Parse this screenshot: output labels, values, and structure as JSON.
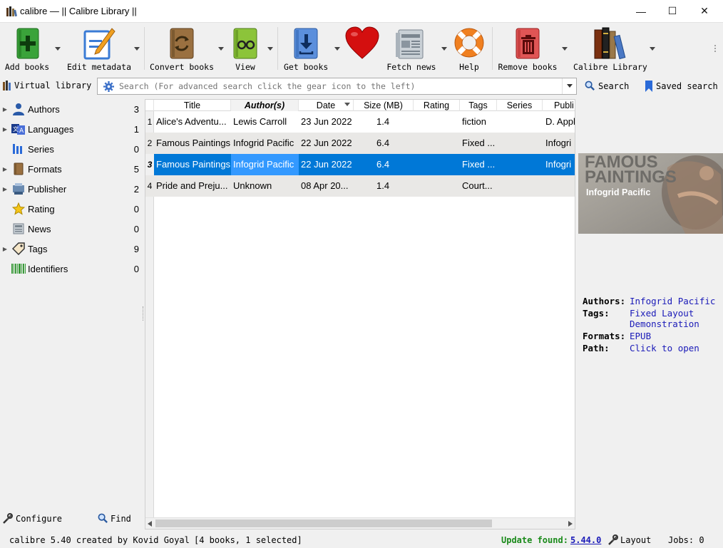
{
  "window": {
    "title": "calibre — || Calibre Library ||",
    "minimize": "—",
    "maximize": "☐",
    "close": "✕"
  },
  "toolbar": {
    "add_books": "Add books",
    "edit_metadata": "Edit metadata",
    "convert_books": "Convert books",
    "view": "View",
    "get_books": "Get books",
    "fetch_news": "Fetch news",
    "help": "Help",
    "remove_books": "Remove books",
    "calibre_library": "Calibre Library"
  },
  "searchbar": {
    "virtual_library": "Virtual library",
    "placeholder": "Search (For advanced search click the gear icon to the left)",
    "search_label": "Search",
    "saved_search_label": "Saved search"
  },
  "tag_browser": {
    "items": [
      {
        "name": "Authors",
        "count": "3",
        "expandable": true,
        "icon": "user-icon"
      },
      {
        "name": "Languages",
        "count": "1",
        "expandable": true,
        "icon": "languages-icon"
      },
      {
        "name": "Series",
        "count": "0",
        "expandable": false,
        "icon": "series-icon"
      },
      {
        "name": "Formats",
        "count": "5",
        "expandable": true,
        "icon": "book-icon"
      },
      {
        "name": "Publisher",
        "count": "2",
        "expandable": true,
        "icon": "publisher-icon"
      },
      {
        "name": "Rating",
        "count": "0",
        "expandable": false,
        "icon": "star-icon"
      },
      {
        "name": "News",
        "count": "0",
        "expandable": false,
        "icon": "news-icon"
      },
      {
        "name": "Tags",
        "count": "9",
        "expandable": true,
        "icon": "tag-icon"
      },
      {
        "name": "Identifiers",
        "count": "0",
        "expandable": false,
        "icon": "barcode-icon"
      }
    ],
    "configure": "Configure",
    "find": "Find"
  },
  "book_list": {
    "columns": [
      "Title",
      "Author(s)",
      "Date",
      "Size (MB)",
      "Rating",
      "Tags",
      "Series",
      "Publi"
    ],
    "rows": [
      {
        "num": "1",
        "title": "Alice's Adventu...",
        "author": "Lewis Carroll",
        "date": "23 Jun 2022",
        "size": "1.4",
        "rating": "",
        "tags": "fiction",
        "series": "",
        "publisher": "D. Appl"
      },
      {
        "num": "2",
        "title": "Famous Paintings",
        "author": "Infogrid Pacific",
        "date": "22 Jun 2022",
        "size": "6.4",
        "rating": "",
        "tags": "Fixed ...",
        "series": "",
        "publisher": "Infogri"
      },
      {
        "num": "3",
        "title": "Famous Paintings",
        "author": "Infogrid Pacific",
        "date": "22 Jun 2022",
        "size": "6.4",
        "rating": "",
        "tags": "Fixed ...",
        "series": "",
        "publisher": "Infogri"
      },
      {
        "num": "4",
        "title": "Pride and Preju...",
        "author": "Unknown",
        "date": "08 Apr 20...",
        "size": "1.4",
        "rating": "",
        "tags": "Court...",
        "series": "",
        "publisher": ""
      }
    ],
    "selected_row": 2
  },
  "details": {
    "cover_title_line1": "FAMOUS",
    "cover_title_line2": "PAINTINGS",
    "cover_author": "Infogrid Pacific",
    "authors_label": "Authors:",
    "authors_value": "Infogrid Pacific",
    "tags_label": "Tags:",
    "tags_value_1": "Fixed Layout",
    "tags_value_2": "Demonstration",
    "formats_label": "Formats:",
    "formats_value": "EPUB",
    "path_label": "Path:",
    "path_value": "Click to open"
  },
  "status": {
    "left": "calibre 5.40 created by Kovid Goyal",
    "count": "[4 books, 1 selected]",
    "update_label": "Update found:",
    "update_version": "5.44.0",
    "layout": "Layout",
    "jobs": "Jobs: 0"
  },
  "colors": {
    "selection": "#0078d7",
    "update_green": "#1a8a1a",
    "link_blue": "#1a1ab8"
  }
}
